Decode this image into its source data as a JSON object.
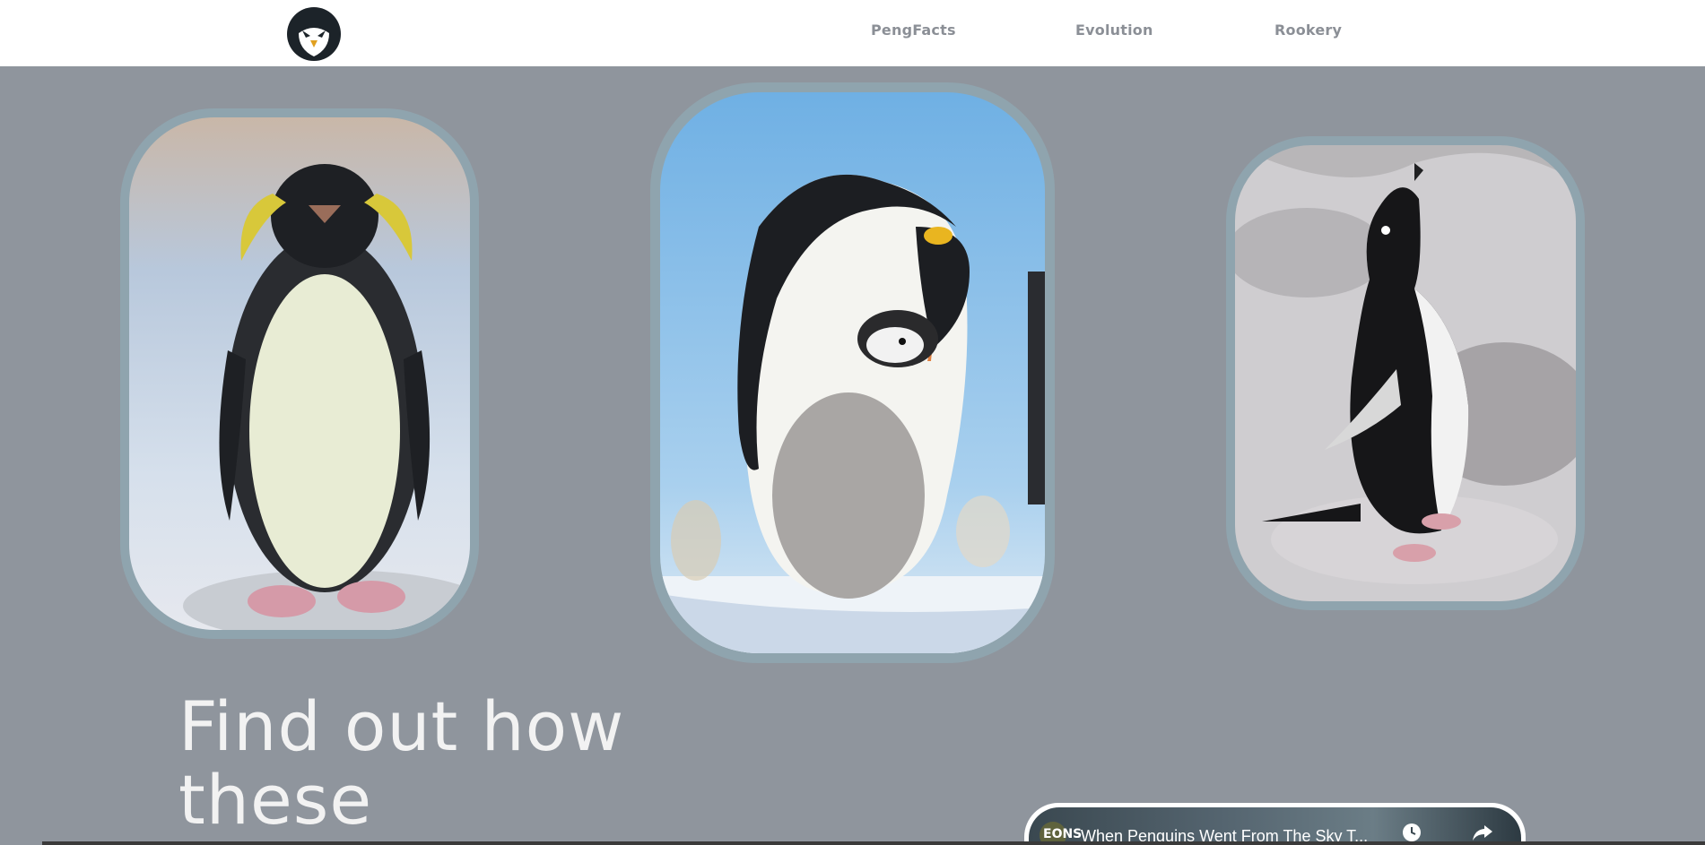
{
  "header": {
    "logo_icon": "penguin-logo-icon",
    "nav": [
      {
        "label": "PengFacts"
      },
      {
        "label": "Evolution"
      },
      {
        "label": "Rookery"
      }
    ]
  },
  "gallery": [
    {
      "subject": "rockhopper-penguin-photo"
    },
    {
      "subject": "emperor-penguin-and-chick-photo"
    },
    {
      "subject": "adelie-penguin-photo"
    }
  ],
  "hero": {
    "heading_line1": "Find out how",
    "heading_line2": "these"
  },
  "video": {
    "channel": "EONS",
    "title": "When Penguins Went From The Sky T...",
    "watch_later_icon": "clock-icon",
    "share_icon": "share-icon"
  },
  "colors": {
    "page_background": "#8f959d",
    "header_background": "#ffffff",
    "frame_border": "#8fa4ae",
    "nav_text": "#8b8f96",
    "heading_text": "#f2f2f2"
  }
}
